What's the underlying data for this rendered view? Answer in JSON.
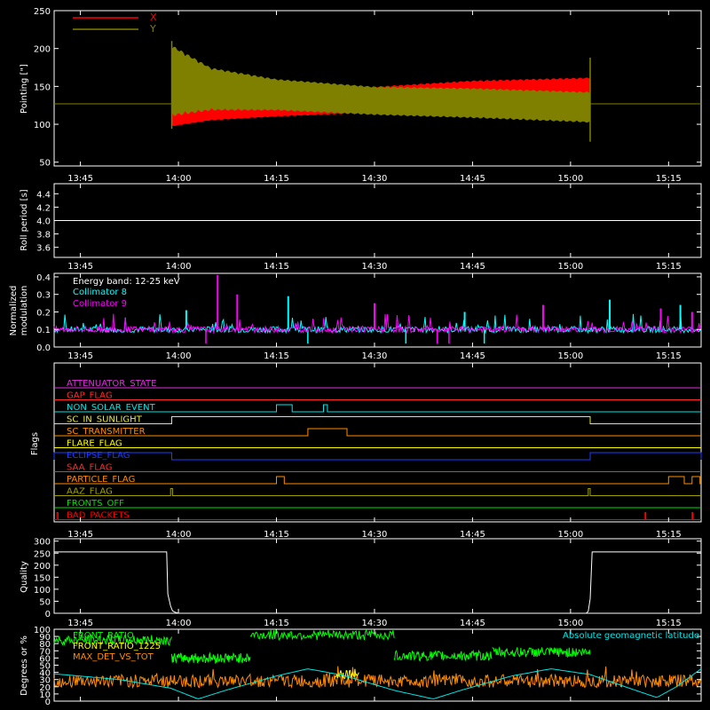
{
  "chart_data": [
    {
      "type": "line",
      "panel": "pointing",
      "ylabel": "Pointing [\"]",
      "ylim": [
        45,
        250
      ],
      "yticks": [
        "50",
        "100",
        "150",
        "200",
        "250"
      ],
      "xticks": [
        "13:45",
        "14:00",
        "14:15",
        "14:30",
        "14:45",
        "15:00",
        "15:15"
      ],
      "legend": "top-left",
      "series": [
        {
          "name": "X",
          "color": "#ff0000",
          "baseline": 127,
          "lower_envelope": [
            [
              13.983,
              97
            ],
            [
              14.083,
              105
            ],
            [
              14.25,
              110
            ],
            [
              14.5,
              115
            ],
            [
              14.75,
              120
            ],
            [
              15.05,
              123
            ]
          ],
          "upper_envelope": [
            [
              13.983,
              122
            ],
            [
              14.083,
              128
            ],
            [
              14.25,
              132
            ],
            [
              14.5,
              150
            ],
            [
              14.75,
              158
            ],
            [
              15.05,
              162
            ]
          ]
        },
        {
          "name": "Y",
          "color": "#808000",
          "baseline": 127,
          "lower_envelope": [
            [
              13.983,
              110
            ],
            [
              14.083,
              118
            ],
            [
              14.25,
              118
            ],
            [
              14.5,
              112
            ],
            [
              14.75,
              108
            ],
            [
              15.05,
              102
            ]
          ],
          "upper_envelope": [
            [
              13.983,
              205
            ],
            [
              14.083,
              175
            ],
            [
              14.25,
              160
            ],
            [
              14.5,
              150
            ],
            [
              14.75,
              148
            ],
            [
              15.05,
              143
            ]
          ]
        }
      ]
    },
    {
      "type": "line",
      "panel": "roll",
      "ylabel": "Roll period [s]",
      "ylim": [
        3.45,
        4.55
      ],
      "yticks": [
        "3.6",
        "3.8",
        "4.0",
        "4.2",
        "4.4"
      ],
      "xticks": [
        "13:45",
        "14:00",
        "14:15",
        "14:30",
        "14:45",
        "15:00",
        "15:15"
      ],
      "series": [
        {
          "color": "#ffffff",
          "values": [
            [
              13.683,
              4.0
            ],
            [
              15.333,
              4.0
            ]
          ]
        }
      ]
    },
    {
      "type": "line",
      "panel": "modulation",
      "ylabel": "Normalized modulation",
      "ylim": [
        0.0,
        0.42
      ],
      "yticks": [
        "0.0",
        "0.1",
        "0.2",
        "0.3",
        "0.4"
      ],
      "xticks": [
        "13:45",
        "14:00",
        "14:15",
        "14:30",
        "14:45",
        "15:00",
        "15:15"
      ],
      "annotation": "Energy band: 12-25 keV",
      "series": [
        {
          "name": "Collimator 8",
          "color": "#00ffff",
          "mean": 0.1,
          "spikes": [
            [
              14.02,
              0.21
            ],
            [
              14.28,
              0.29
            ],
            [
              14.73,
              0.2
            ],
            [
              15.1,
              0.27
            ],
            [
              15.28,
              0.24
            ]
          ],
          "dips": [
            [
              14.33,
              0.02
            ],
            [
              14.58,
              0.02
            ],
            [
              14.78,
              0.02
            ]
          ]
        },
        {
          "name": "Collimator 9",
          "color": "#ff00ff",
          "mean": 0.1,
          "spikes": [
            [
              14.1,
              0.41
            ],
            [
              14.15,
              0.3
            ],
            [
              14.5,
              0.25
            ],
            [
              14.93,
              0.24
            ],
            [
              15.23,
              0.22
            ],
            [
              15.31,
              0.2
            ]
          ],
          "dips": [
            [
              14.07,
              0.02
            ],
            [
              14.66,
              0.02
            ],
            [
              14.69,
              0.02
            ]
          ]
        }
      ]
    },
    {
      "type": "line",
      "panel": "flags",
      "ylabel": "Flags",
      "xticks": [
        "13:45",
        "14:00",
        "14:15",
        "14:30",
        "14:45",
        "15:00",
        "15:15"
      ],
      "flags": [
        {
          "name": "ATTENUATOR_STATE",
          "color": "#e02ee0",
          "high": []
        },
        {
          "name": "GAP_FLAG",
          "color": "#ff2a2a",
          "high": []
        },
        {
          "name": "NON_SOLAR_EVENT",
          "color": "#00e5e5",
          "high": [
            [
              14.25,
              14.29
            ],
            [
              14.37,
              14.38
            ]
          ]
        },
        {
          "name": "SC_IN_SUNLIGHT",
          "color": "#e8e84a",
          "high": [
            [
              13.983,
              15.05
            ]
          ]
        },
        {
          "name": "SC_TRANSMITTER",
          "color": "#ff8c00",
          "high": [
            [
              14.33,
              14.43
            ]
          ]
        },
        {
          "name": "FLARE_FLAG",
          "color": "#ffff00",
          "high": []
        },
        {
          "name": "ECLIPSE_FLAG",
          "color": "#1a3fff",
          "high": [
            [
              13.683,
              13.983
            ],
            [
              15.05,
              15.333
            ]
          ]
        },
        {
          "name": "SAA_FLAG",
          "color": "#ff2a2a",
          "high": []
        },
        {
          "name": "PARTICLE_FLAG",
          "color": "#ff8c00",
          "high": [
            [
              14.25,
              14.27
            ],
            [
              15.25,
              15.29
            ],
            [
              15.31,
              15.33
            ]
          ]
        },
        {
          "name": "AAZ_FLAG",
          "color": "#a0a000",
          "high": [
            [
              13.98,
              13.985
            ],
            [
              15.045,
              15.05
            ]
          ]
        },
        {
          "name": "FRONTS_OFF",
          "color": "#00e000",
          "high": []
        },
        {
          "name": "BAD_PACKETS",
          "color": "#ff0000",
          "high": [
            [
              13.69,
              13.693
            ],
            [
              15.19,
              15.192
            ],
            [
              15.31,
              15.312
            ]
          ]
        }
      ]
    },
    {
      "type": "line",
      "panel": "quality",
      "ylabel": "Quality",
      "ylim": [
        0,
        310
      ],
      "yticks": [
        "0",
        "50",
        "100",
        "150",
        "200",
        "250",
        "300"
      ],
      "xticks": [
        "13:45",
        "14:00",
        "14:15",
        "14:30",
        "14:45",
        "15:00",
        "15:15"
      ],
      "series": [
        {
          "color": "#ffffff",
          "values": [
            [
              13.683,
              255
            ],
            [
              13.97,
              255
            ],
            [
              13.973,
              80
            ],
            [
              13.98,
              30
            ],
            [
              13.985,
              10
            ],
            [
              13.99,
              5
            ],
            [
              14.0,
              0
            ],
            [
              15.04,
              0
            ],
            [
              15.045,
              8
            ],
            [
              15.05,
              60
            ],
            [
              15.055,
              255
            ],
            [
              15.333,
              255
            ]
          ]
        }
      ]
    },
    {
      "type": "line",
      "panel": "ratios",
      "ylabel": "Degrees or %",
      "ylim": [
        0,
        100
      ],
      "yticks": [
        "0",
        "10",
        "20",
        "30",
        "40",
        "50",
        "60",
        "70",
        "80",
        "90",
        "100"
      ],
      "xticks": [
        "13:45",
        "14:00",
        "14:15",
        "14:30",
        "14:45",
        "15:00",
        "15:15"
      ],
      "legend_right": "Absolute geomagnetic latitude",
      "series": [
        {
          "name": "FRONT_RATIO",
          "color": "#00ff00",
          "levels": [
            [
              13.683,
              13.983,
              85
            ],
            [
              13.983,
              14.183,
              60
            ],
            [
              14.183,
              14.55,
              92
            ],
            [
              14.55,
              14.8,
              63
            ],
            [
              14.8,
              15.05,
              68
            ]
          ]
        },
        {
          "name": "FRONT_RATIO_1225",
          "color": "#ffff00"
        },
        {
          "name": "MAX_DET_VS_TOT",
          "color": "#ff8c00",
          "mean": 28
        },
        {
          "name": "Absolute geomagnetic latitude",
          "color": "#00e5e5",
          "values": [
            [
              13.683,
              38
            ],
            [
              13.85,
              30
            ],
            [
              13.98,
              18
            ],
            [
              14.05,
              3
            ],
            [
              14.12,
              15
            ],
            [
              14.25,
              35
            ],
            [
              14.33,
              45
            ],
            [
              14.42,
              36
            ],
            [
              14.55,
              15
            ],
            [
              14.65,
              3
            ],
            [
              14.72,
              15
            ],
            [
              14.85,
              35
            ],
            [
              14.95,
              45
            ],
            [
              15.05,
              37
            ],
            [
              15.15,
              18
            ],
            [
              15.22,
              5
            ],
            [
              15.27,
              20
            ],
            [
              15.333,
              45
            ]
          ]
        }
      ]
    }
  ]
}
